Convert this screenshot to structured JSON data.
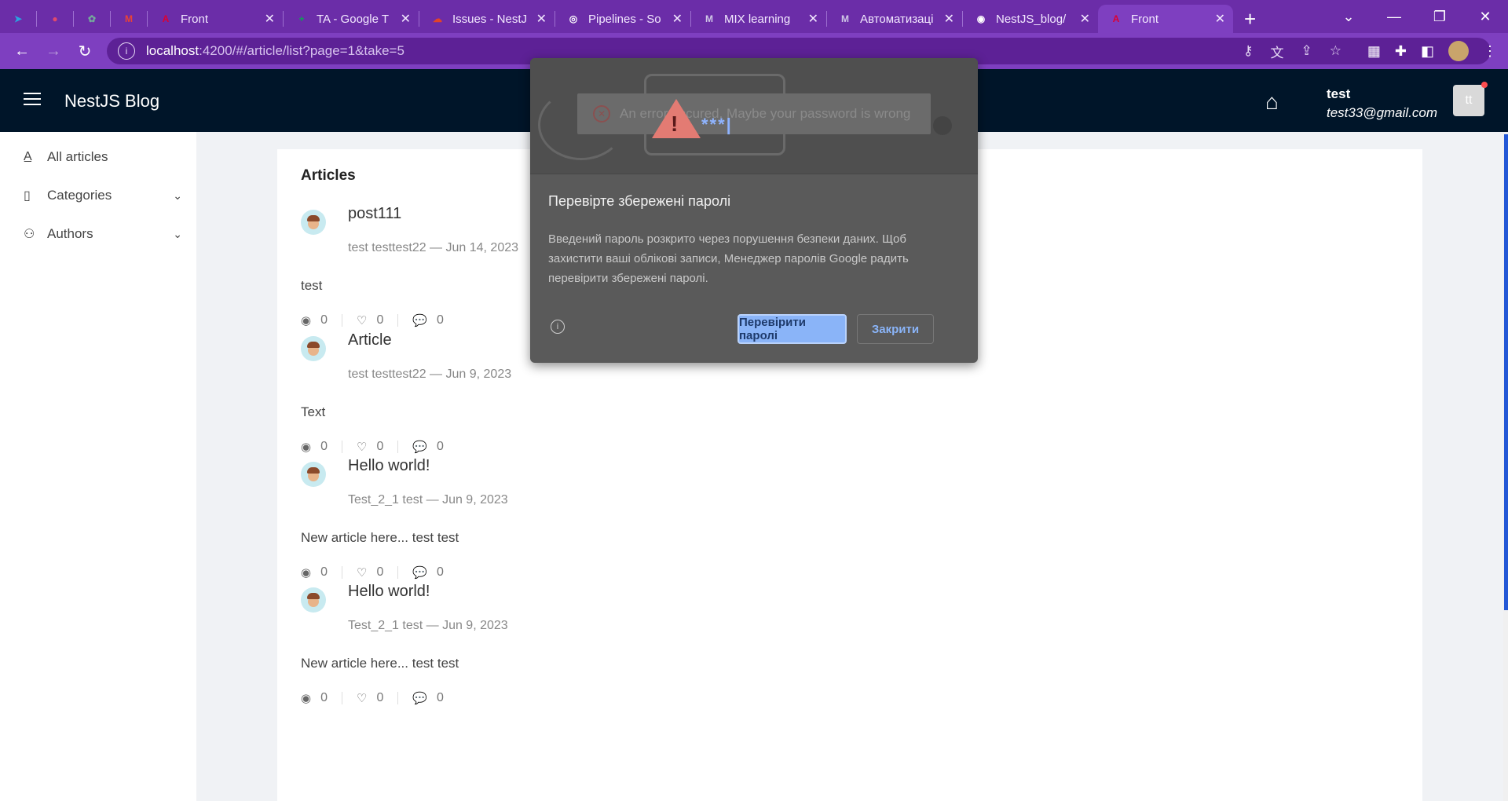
{
  "browser": {
    "tabs": [
      {
        "label": "",
        "icon": "telegram-icon",
        "icon_char": "➤",
        "color": "#2aa3e0",
        "kind": "small"
      },
      {
        "label": "",
        "icon": "record-icon",
        "icon_char": "●",
        "color": "#e0496d",
        "kind": "small"
      },
      {
        "label": "",
        "icon": "chatgpt-icon",
        "icon_char": "✿",
        "color": "#74aa9c",
        "kind": "small"
      },
      {
        "label": "",
        "icon": "gmail-icon",
        "icon_char": "M",
        "color": "#ea4335",
        "kind": "small"
      },
      {
        "label": "Front",
        "icon": "angular-icon",
        "icon_char": "A",
        "color": "#dd0031",
        "kind": "wide"
      },
      {
        "label": "TA - Google T",
        "icon": "sheets-icon",
        "icon_char": "+",
        "color": "#0f9d58",
        "kind": "wide"
      },
      {
        "label": "Issues - NestJ",
        "icon": "cloud-icon",
        "icon_char": "☁",
        "color": "#e24329",
        "kind": "wide"
      },
      {
        "label": "Pipelines - So",
        "icon": "pipelines-icon",
        "icon_char": "◎",
        "color": "#ffffff",
        "kind": "wide"
      },
      {
        "label": "MIX learning",
        "icon": "mix-icon",
        "icon_char": "M",
        "color": "#cfc7e6",
        "kind": "wide"
      },
      {
        "label": "Автоматизаці",
        "icon": "mix-icon",
        "icon_char": "M",
        "color": "#cfc7e6",
        "kind": "wide"
      },
      {
        "label": "NestJS_blog/",
        "icon": "github-icon",
        "icon_char": "◉",
        "color": "#ffffff",
        "kind": "wide"
      },
      {
        "label": "Front",
        "icon": "angular-icon",
        "icon_char": "A",
        "color": "#dd0031",
        "kind": "wide active"
      }
    ],
    "url_host": "localhost",
    "url_rest": ":4200/#/article/list?page=1&take=5"
  },
  "header": {
    "brand": "NestJS Blog",
    "user_name": "test",
    "user_email": "test33@gmail.com",
    "avatar_initials": "tt"
  },
  "sidebar": {
    "items": [
      {
        "label": "All articles",
        "icon": "font-icon"
      },
      {
        "label": "Categories",
        "icon": "book-icon"
      },
      {
        "label": "Authors",
        "icon": "users-icon"
      }
    ]
  },
  "main": {
    "title": "Articles",
    "articles": [
      {
        "title": "post111",
        "meta": "test testtest22 — Jun 14, 2023",
        "body": "test",
        "views": "0",
        "likes": "0",
        "comments": "0"
      },
      {
        "title": "Article",
        "meta": "test testtest22 — Jun 9, 2023",
        "body": "Text",
        "views": "0",
        "likes": "0",
        "comments": "0"
      },
      {
        "title": "Hello world!",
        "meta": "Test_2_1 test — Jun 9, 2023",
        "body": "New article here... test test",
        "views": "0",
        "likes": "0",
        "comments": "0"
      },
      {
        "title": "Hello world!",
        "meta": "Test_2_1 test — Jun 9, 2023",
        "body": "New article here... test test",
        "views": "0",
        "likes": "0",
        "comments": "0"
      }
    ]
  },
  "dialog": {
    "hero_error_text": "An error occured. Maybe your password is wrong",
    "hero_stars": "***|",
    "title": "Перевірте збережені паролі",
    "text": "Введений пароль розкрито через порушення безпеки даних. Щоб захистити ваші облікові записи, Менеджер паролів Google радить перевірити збережені паролі.",
    "primary_button": "Перевірити паролі",
    "secondary_button": "Закрити"
  }
}
